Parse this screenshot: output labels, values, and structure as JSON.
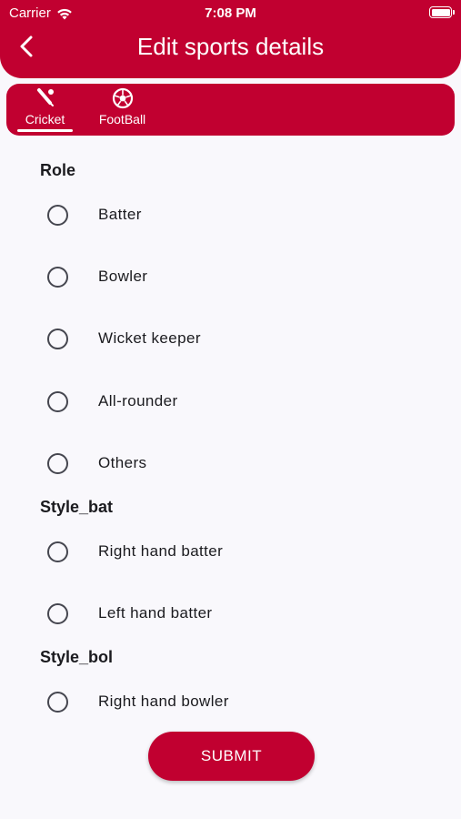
{
  "status_bar": {
    "carrier": "Carrier",
    "time": "7:08 PM",
    "battery_level": 1.0
  },
  "header": {
    "title": "Edit sports details",
    "back_icon": "chevron-left-icon"
  },
  "tabs": [
    {
      "label": "Cricket",
      "icon": "cricket-icon",
      "selected": true
    },
    {
      "label": "FootBall",
      "icon": "football-icon",
      "selected": false
    }
  ],
  "sections": {
    "role": {
      "title": "Role",
      "options": [
        "Batter",
        "Bowler",
        "Wicket keeper",
        "All-rounder",
        "Others"
      ]
    },
    "style_bat": {
      "title": "Style_bat",
      "options": [
        "Right hand batter",
        "Left hand batter"
      ]
    },
    "style_bol": {
      "title": "Style_bol",
      "options": [
        "Right hand bowler"
      ]
    }
  },
  "submit_label": "SUBMIT",
  "colors": {
    "primary": "#c10030",
    "background": "#f9f8fc",
    "text": "#1b1b1f",
    "radio_border": "#45464f"
  }
}
